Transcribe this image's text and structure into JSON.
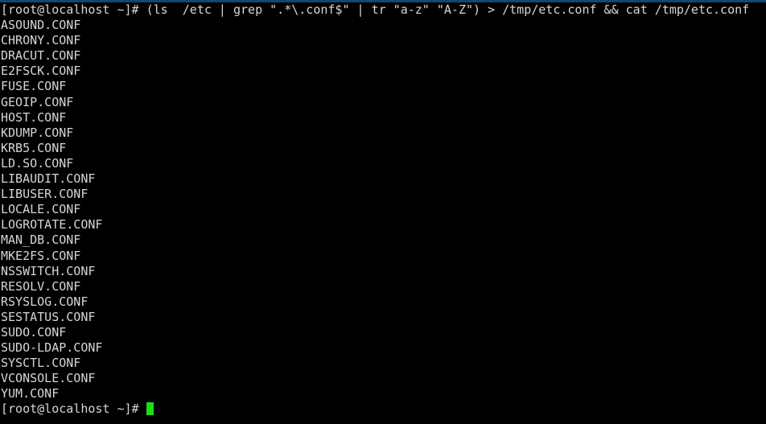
{
  "window": {
    "title": "root@localhost:~",
    "type": "terminal",
    "cols": 99,
    "rows": 27,
    "colors": {
      "background": "#000000",
      "foreground": "#d6d6d6",
      "top_bar": "#11486f",
      "cursor": "#18e018"
    }
  },
  "terminal": {
    "command_line": {
      "prompt": "[root@localhost ~]# ",
      "command": "(ls  /etc | grep \".*\\.conf$\" | tr \"a-z\" \"A-Z\") > /tmp/etc.conf && cat /tmp/etc.conf",
      "full_text": "[root@localhost ~]# (ls  /etc | grep \".*\\.conf$\" | tr \"a-z\" \"A-Z\") > /tmp/etc.conf && cat /tmp/etc.conf"
    },
    "output_lines": [
      "ASOUND.CONF",
      "CHRONY.CONF",
      "DRACUT.CONF",
      "E2FSCK.CONF",
      "FUSE.CONF",
      "GEOIP.CONF",
      "HOST.CONF",
      "KDUMP.CONF",
      "KRB5.CONF",
      "LD.SO.CONF",
      "LIBAUDIT.CONF",
      "LIBUSER.CONF",
      "LOCALE.CONF",
      "LOGROTATE.CONF",
      "MAN_DB.CONF",
      "MKE2FS.CONF",
      "NSSWITCH.CONF",
      "RESOLV.CONF",
      "RSYSLOG.CONF",
      "SESTATUS.CONF",
      "SUDO.CONF",
      "SUDO-LDAP.CONF",
      "SYSCTL.CONF",
      "VCONSOLE.CONF",
      "YUM.CONF"
    ],
    "final_prompt": "[root@localhost ~]# "
  }
}
